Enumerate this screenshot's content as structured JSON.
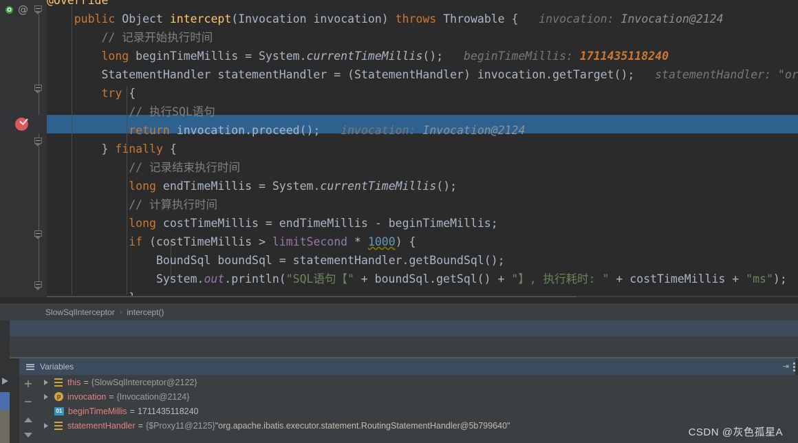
{
  "editor": {
    "language": "java",
    "lines": [
      {
        "id": "line-override-partial",
        "tokens": [
          {
            "t": "@Override",
            "c": "mth"
          }
        ]
      },
      {
        "id": "line-method-signature",
        "tokens": [
          {
            "t": "    ",
            "c": "txt"
          },
          {
            "t": "public",
            "c": "kw"
          },
          {
            "t": " Object ",
            "c": "txt"
          },
          {
            "t": "intercept",
            "c": "mth"
          },
          {
            "t": "(Invocation invocation) ",
            "c": "txt"
          },
          {
            "t": "throws",
            "c": "kw"
          },
          {
            "t": " Throwable {",
            "c": "txt"
          },
          {
            "t": "   invocation: ",
            "c": "hint"
          },
          {
            "t": "Invocation@2124",
            "c": "hintval2"
          }
        ]
      },
      {
        "id": "line-comment-begin",
        "tokens": [
          {
            "t": "        // 记录开始执行时间",
            "c": "cmt"
          }
        ]
      },
      {
        "id": "line-begin-time-millis",
        "tokens": [
          {
            "t": "        ",
            "c": "txt"
          },
          {
            "t": "long",
            "c": "kw"
          },
          {
            "t": " beginTimeMillis = System.",
            "c": "txt"
          },
          {
            "t": "currentTimeMillis",
            "c": "stat"
          },
          {
            "t": "();",
            "c": "txt"
          },
          {
            "t": "   beginTimeMillis: ",
            "c": "hint"
          },
          {
            "t": "1711435118240",
            "c": "hintval"
          }
        ]
      },
      {
        "id": "line-statement-handler",
        "tokens": [
          {
            "t": "        StatementHandler statementHandler = (StatementHandler) invocation.getTarget();",
            "c": "txt"
          },
          {
            "t": "   statementHandler: \"org",
            "c": "hint"
          }
        ]
      },
      {
        "id": "line-try",
        "tokens": [
          {
            "t": "        ",
            "c": "txt"
          },
          {
            "t": "try",
            "c": "kw"
          },
          {
            "t": " {",
            "c": "txt"
          }
        ]
      },
      {
        "id": "line-comment-exec-sql",
        "tokens": [
          {
            "t": "            // 执行SQL语句",
            "c": "cmt"
          }
        ]
      },
      {
        "id": "line-return-proceed",
        "highlighted": true,
        "breakpoint": true,
        "tokens": [
          {
            "t": "            ",
            "c": "txt"
          },
          {
            "t": "return",
            "c": "kw"
          },
          {
            "t": " invocation.proceed",
            "c": "txt"
          },
          {
            "t": "();",
            "c": "txt"
          },
          {
            "t": "   invocation: ",
            "c": "hint"
          },
          {
            "t": "Invocation@2124",
            "c": "hintval2"
          }
        ]
      },
      {
        "id": "line-finally",
        "tokens": [
          {
            "t": "        } ",
            "c": "txt"
          },
          {
            "t": "finally",
            "c": "kw"
          },
          {
            "t": " {",
            "c": "txt"
          }
        ]
      },
      {
        "id": "line-comment-end",
        "tokens": [
          {
            "t": "            // 记录结束执行时间",
            "c": "cmt"
          }
        ]
      },
      {
        "id": "line-end-time-millis",
        "tokens": [
          {
            "t": "            ",
            "c": "txt"
          },
          {
            "t": "long",
            "c": "kw"
          },
          {
            "t": " endTimeMillis = System.",
            "c": "txt"
          },
          {
            "t": "currentTimeMillis",
            "c": "stat"
          },
          {
            "t": "();",
            "c": "txt"
          }
        ]
      },
      {
        "id": "line-comment-cost",
        "tokens": [
          {
            "t": "            // 计算执行时间",
            "c": "cmt"
          }
        ]
      },
      {
        "id": "line-cost-time-millis",
        "tokens": [
          {
            "t": "            ",
            "c": "txt"
          },
          {
            "t": "long",
            "c": "kw"
          },
          {
            "t": " costTimeMillis = endTimeMillis - beginTimeMillis;",
            "c": "txt"
          }
        ]
      },
      {
        "id": "line-if-limit",
        "tokens": [
          {
            "t": "            ",
            "c": "txt"
          },
          {
            "t": "if",
            "c": "kw"
          },
          {
            "t": " (costTimeMillis > ",
            "c": "txt"
          },
          {
            "t": "limitSecond",
            "c": "field"
          },
          {
            "t": " * ",
            "c": "txt"
          },
          {
            "t": "1000",
            "c": "num-u"
          },
          {
            "t": ") {",
            "c": "txt"
          }
        ]
      },
      {
        "id": "line-bound-sql",
        "tokens": [
          {
            "t": "                BoundSql boundSql = statementHandler.getBoundSql();",
            "c": "txt"
          }
        ]
      },
      {
        "id": "line-println",
        "tokens": [
          {
            "t": "                System.",
            "c": "txt"
          },
          {
            "t": "out",
            "c": "fieldi"
          },
          {
            "t": ".println(",
            "c": "txt"
          },
          {
            "t": "\"SQL语句【\"",
            "c": "str"
          },
          {
            "t": " + boundSql.getSql() + ",
            "c": "txt"
          },
          {
            "t": "\"】, 执行耗时: \"",
            "c": "str"
          },
          {
            "t": " + costTimeMillis + ",
            "c": "txt"
          },
          {
            "t": "\"ms\"",
            "c": "str"
          },
          {
            "t": ");",
            "c": "txt"
          }
        ]
      },
      {
        "id": "line-close-if",
        "tokens": [
          {
            "t": "            }",
            "c": "txt"
          }
        ]
      },
      {
        "id": "line-close-finally-partial",
        "tokens": [
          {
            "t": "        }",
            "c": "txt"
          }
        ]
      }
    ],
    "gutter": {
      "implements_marker": "O",
      "annotation_marker": "@",
      "breakpoint_tooltip": "verified-breakpoint"
    }
  },
  "breadcrumb": {
    "items": [
      "SlowSqlInterceptor",
      "intercept()"
    ],
    "separator": "›"
  },
  "debug_panel": {
    "variables_tab": {
      "label": "Variables"
    },
    "toolbar": {
      "add": "+",
      "remove": "−",
      "move_up": "▲",
      "move_down": "▼"
    },
    "variables": [
      {
        "name": "this",
        "icon": "object-icon",
        "expandable": true,
        "equals": "=",
        "value_ref": "{SlowSqlInterceptor@2122}",
        "value_str": ""
      },
      {
        "name": "invocation",
        "icon": "parameter-icon",
        "icon_label": "p",
        "expandable": true,
        "equals": "=",
        "value_ref": "{Invocation@2124}",
        "value_str": ""
      },
      {
        "name": "beginTimeMillis",
        "icon": "primitive-icon",
        "icon_label": "01",
        "expandable": false,
        "equals": "=",
        "value_ref": "",
        "value_num": "1711435118240",
        "value_str": ""
      },
      {
        "name": "statementHandler",
        "icon": "object-icon",
        "expandable": true,
        "equals": "=",
        "value_ref": "{$Proxy11@2125}",
        "value_str": "\"org.apache.ibatis.executor.statement.RoutingStatementHandler@5b799640\""
      }
    ]
  },
  "watermark": {
    "text": "CSDN @灰色孤星A"
  },
  "colors": {
    "editor_bg": "#2b2b2b",
    "gutter_bg": "#313335",
    "selection_blue": "#2f618f",
    "panel_bg": "#3c3f41",
    "tab_blue": "#3c4c5e",
    "keyword_orange": "#cc7832",
    "string_green": "#6a8759",
    "number_blue": "#6897bb",
    "comment_gray": "#808080",
    "field_purple": "#9876aa",
    "method_yellow": "#ffc66d",
    "breakpoint_red": "#db5860",
    "var_name_red": "#e08283"
  }
}
